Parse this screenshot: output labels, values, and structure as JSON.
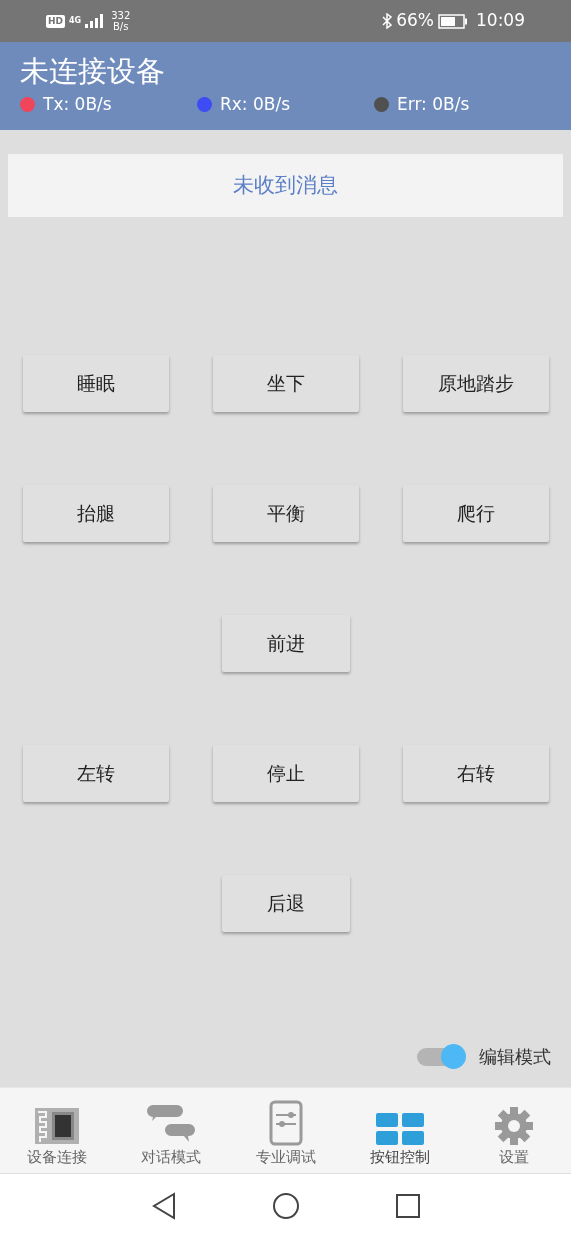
{
  "status_bar": {
    "hd": "HD",
    "network": "4G",
    "speed": "332",
    "speed_unit": "B/s",
    "battery": "66%",
    "time": "10:09"
  },
  "header": {
    "title": "未连接设备",
    "stats": [
      {
        "label": "Tx: 0B/s",
        "color": "#f0455a"
      },
      {
        "label": "Rx: 0B/s",
        "color": "#3d4cf5"
      },
      {
        "label": "Err: 0B/s",
        "color": "#505050"
      }
    ]
  },
  "message": "未收到消息",
  "button_rows": [
    [
      "睡眠",
      "坐下",
      "原地踏步"
    ],
    [
      "抬腿",
      "平衡",
      "爬行"
    ],
    [
      "前进"
    ],
    [
      "左转",
      "停止",
      "右转"
    ],
    [
      "后退"
    ]
  ],
  "edit_mode": {
    "label": "编辑模式",
    "on": true
  },
  "nav": [
    {
      "label": "设备连接",
      "kind": "device",
      "selected": false
    },
    {
      "label": "对话模式",
      "kind": "chat",
      "selected": false
    },
    {
      "label": "专业调试",
      "kind": "tuning",
      "selected": false
    },
    {
      "label": "按钮控制",
      "kind": "grid",
      "selected": true
    },
    {
      "label": "设置",
      "kind": "gear",
      "selected": false
    }
  ]
}
